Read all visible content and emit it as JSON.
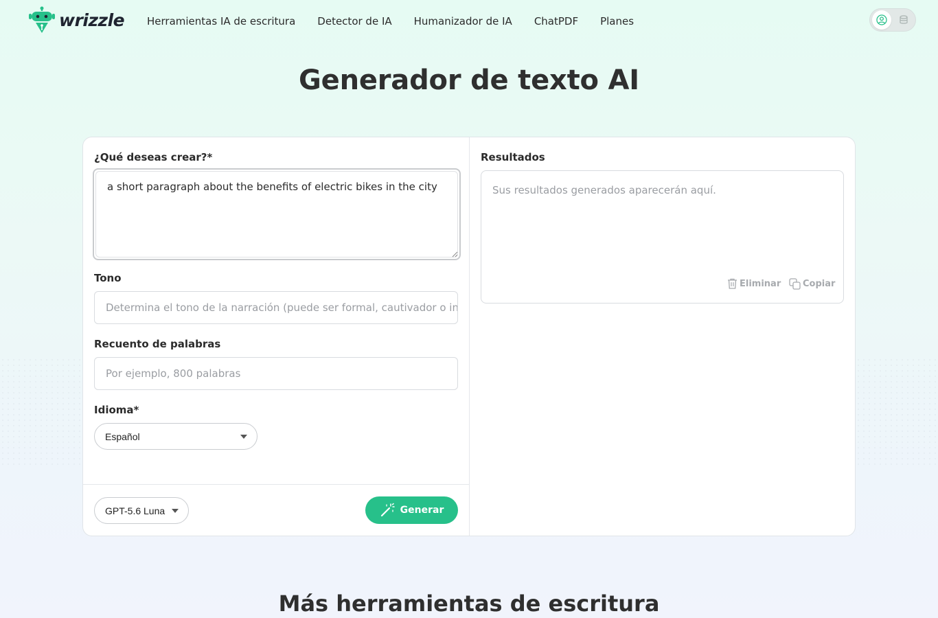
{
  "brand": {
    "name": "wrizzle",
    "accent": "#27c08a"
  },
  "nav": {
    "items": [
      {
        "label": "Herramientas IA de escritura"
      },
      {
        "label": "Detector de IA"
      },
      {
        "label": "Humanizador de IA"
      },
      {
        "label": "ChatPDF"
      },
      {
        "label": "Planes"
      }
    ]
  },
  "page": {
    "title": "Generador de texto AI"
  },
  "form": {
    "prompt": {
      "label": "¿Qué deseas crear?*",
      "value": "a short paragraph about the benefits of electric bikes in the city"
    },
    "tone": {
      "label": "Tono",
      "placeholder": "Determina el tono de la narración (puede ser formal, cautivador o inf"
    },
    "word_count": {
      "label": "Recuento de palabras",
      "placeholder": "Por ejemplo, 800 palabras"
    },
    "language": {
      "label": "Idioma*",
      "selected": "Español"
    },
    "model": {
      "selected": "GPT-5.6 Luna"
    },
    "generate_label": "Generar"
  },
  "results": {
    "label": "Resultados",
    "placeholder": "Sus resultados generados aparecerán aquí.",
    "delete_label": "Eliminar",
    "copy_label": "Copiar"
  },
  "more_tools": {
    "title": "Más herramientas de escritura"
  },
  "icons": {
    "logo": "robot-pen-icon",
    "user": "user-icon",
    "credits": "database-icon",
    "generate": "magic-wand-icon",
    "delete": "trash-icon",
    "copy": "copy-icon",
    "dropdown": "caret-down-icon"
  }
}
